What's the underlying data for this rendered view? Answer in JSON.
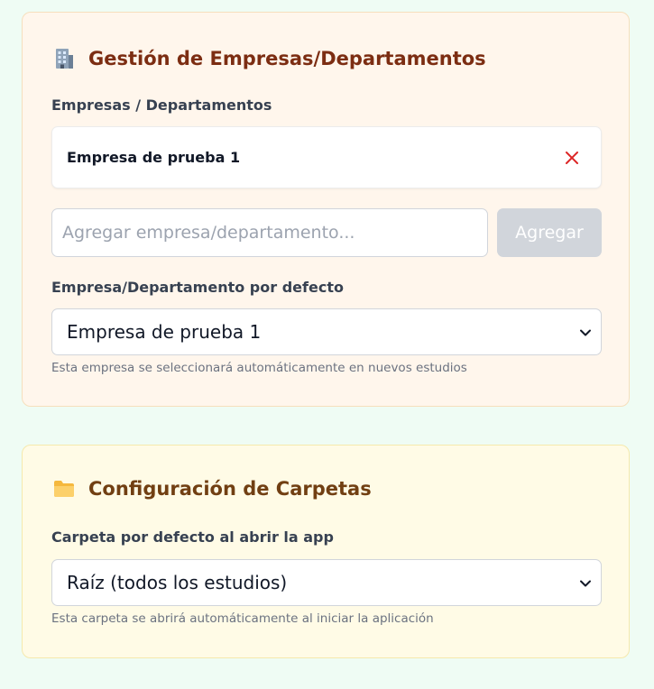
{
  "empresas": {
    "title": "Gestión de Empresas/Departamentos",
    "icon": "office-building-icon",
    "list_label": "Empresas / Departamentos",
    "items": [
      {
        "label": "Empresa de prueba 1",
        "remove_icon": "close-icon"
      }
    ],
    "new_input": {
      "value": "",
      "placeholder": "Agregar empresa/departamento..."
    },
    "add_button_label": "Agregar",
    "default_label": "Empresa/Departamento por defecto",
    "default_selected": "Empresa de prueba 1",
    "default_help": "Esta empresa se seleccionará automáticamente en nuevos estudios"
  },
  "carpetas": {
    "title": "Configuración de Carpetas",
    "icon": "folder-icon",
    "default_label": "Carpeta por defecto al abrir la app",
    "default_selected": "Raíz (todos los estudios)",
    "default_help": "Esta carpeta se abrirá automáticamente al iniciar la aplicación"
  },
  "colors": {
    "page_background": "#effcf4",
    "empresas_card": "#fff6ec",
    "empresas_title": "#7c2d12",
    "carpetas_card": "#fffbe6",
    "carpetas_title": "#713f12",
    "remove_icon": "#dc2626",
    "disabled_button": "#d1d5db"
  }
}
